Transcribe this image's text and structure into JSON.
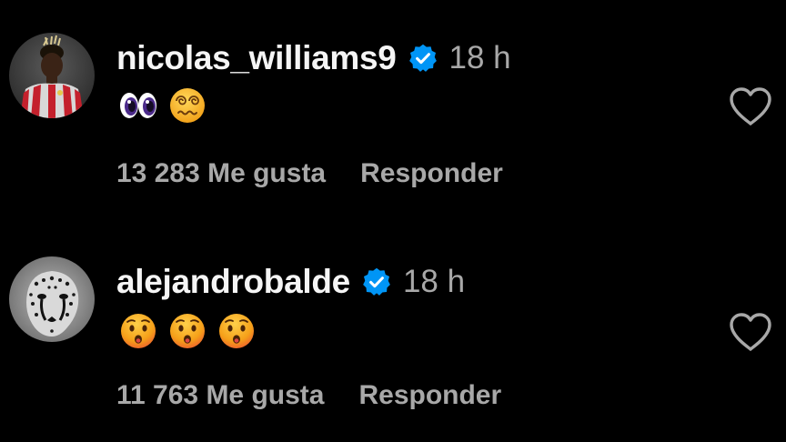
{
  "comments": [
    {
      "username": "nicolas_williams9",
      "time": "18 h",
      "emojis": [
        "eyes",
        "dizzy-face"
      ],
      "likes": "13 283 Me gusta",
      "reply_label": "Responder"
    },
    {
      "username": "alejandrobalde",
      "time": "18 h",
      "emojis": [
        "hushed-face",
        "hushed-face",
        "hushed-face"
      ],
      "likes": "11 763 Me gusta",
      "reply_label": "Responder"
    }
  ],
  "icons": {
    "verified": "verified-badge-icon",
    "like": "heart-outline-icon"
  },
  "colors": {
    "background": "#000000",
    "text_primary": "#f5f5f5",
    "text_secondary": "#a8a8a8",
    "verified_blue": "#0095f6"
  }
}
